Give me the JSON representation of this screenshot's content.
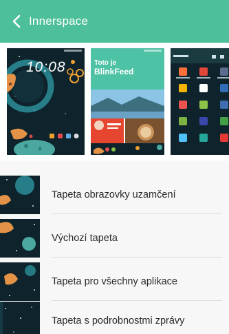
{
  "header": {
    "title": "Innerspace",
    "back_icon": "chevron-left-icon"
  },
  "previews": {
    "lock_screen_clock": "10:08",
    "blinkfeed_line1": "Toto je",
    "blinkfeed_line2": "BlinkFeed"
  },
  "list": {
    "items": [
      {
        "label": "Tapeta obrazovky uzamčení"
      },
      {
        "label": "Výchozí tapeta"
      },
      {
        "label": "Tapeta pro všechny aplikace"
      },
      {
        "label": "Tapeta s podrobnostmi zprávy"
      }
    ]
  },
  "colors": {
    "accent": "#4dbf9a",
    "wallpaper_dark": "#0e232b"
  }
}
